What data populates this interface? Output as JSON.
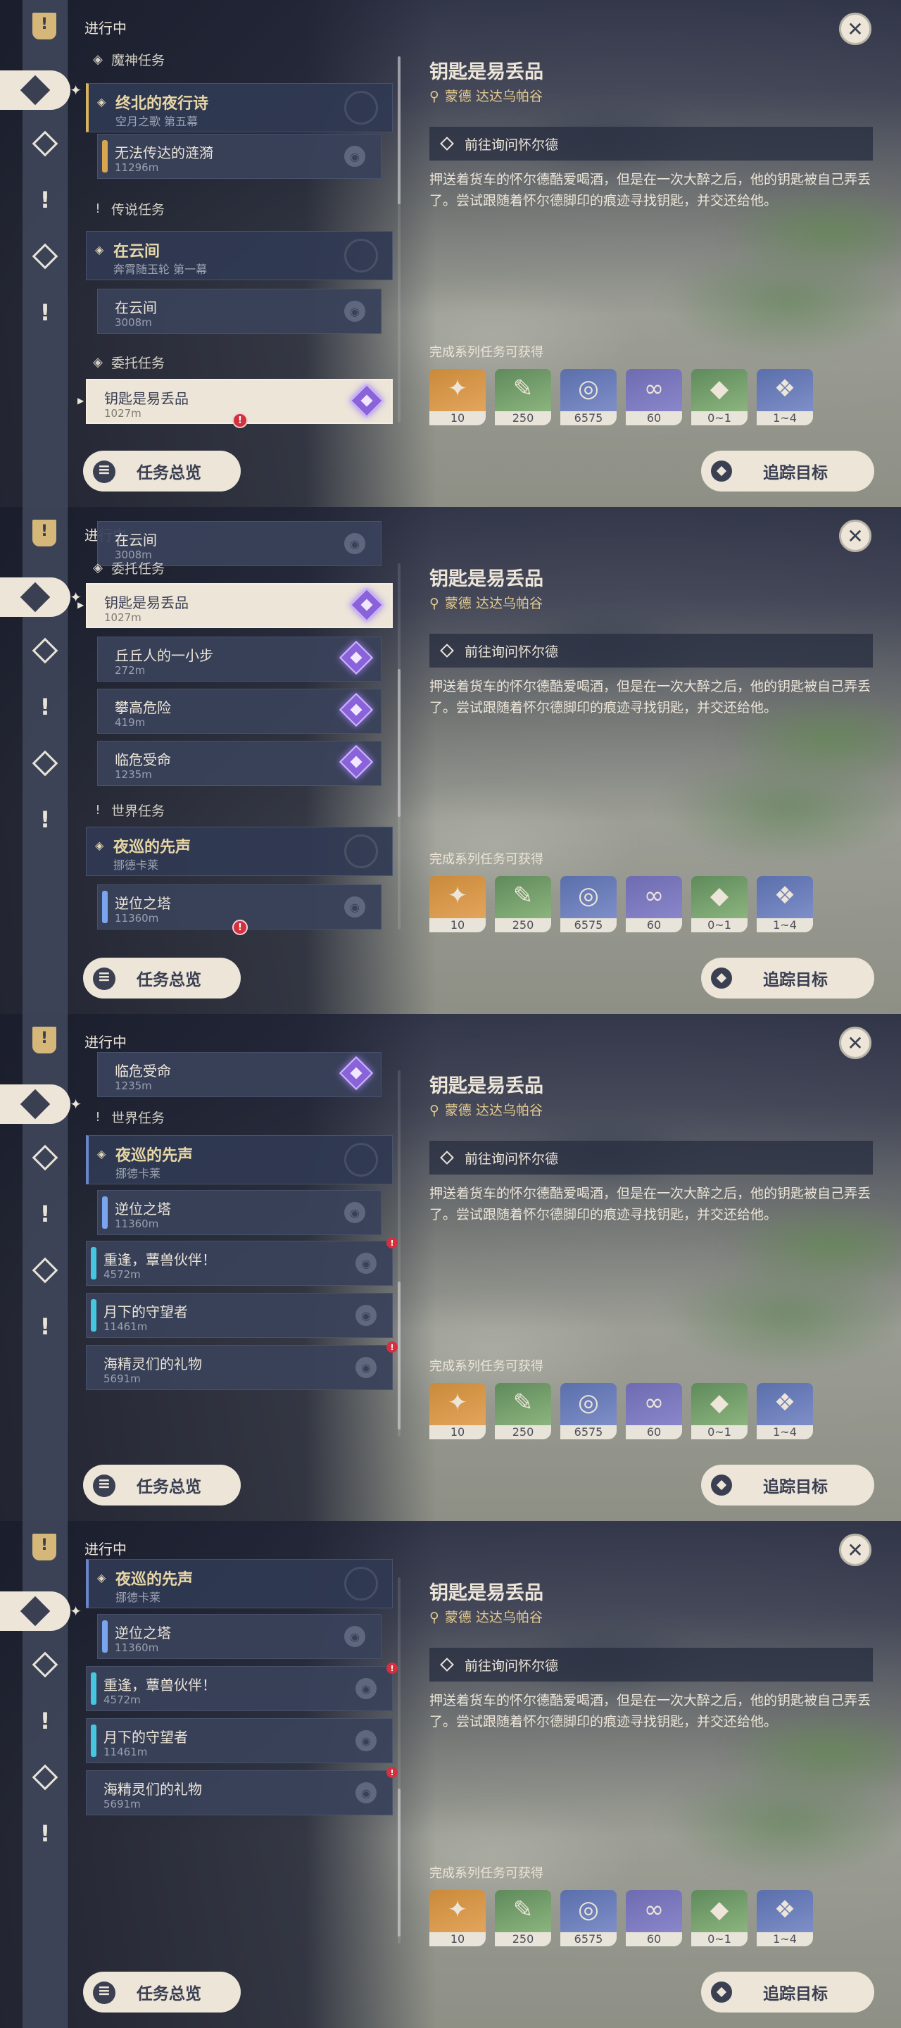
{
  "header": {
    "section_title": "进行中",
    "close_symbol": "✕"
  },
  "icons": {
    "rail": [
      "quest-bookmark-icon",
      "all-quests-icon",
      "archon-quest-icon",
      "story-quest-icon",
      "commission-icon",
      "world-quest-icon"
    ],
    "pin": "map-pin-icon",
    "track": "track-diamond-icon"
  },
  "colors": {
    "accent_gold": "#d9b35f",
    "commission_purple": "#8a62d9",
    "world_cyan": "#45c7e2",
    "alert_red": "#d33040",
    "cream": "#ece5d8"
  },
  "categories": {
    "archon": "魔神任务",
    "legend": "传说任务",
    "commission": "委托任务",
    "world": "世界任务"
  },
  "quests": {
    "archon_chapter": {
      "title": "终北的夜行诗",
      "subtitle": "空月之歌 第五幕"
    },
    "archon_step": {
      "title": "无法传达的涟漪",
      "distance": "11296m"
    },
    "legend_chapter": {
      "title": "在云间",
      "subtitle": "奔霄随玉轮 第一幕"
    },
    "legend_step": {
      "title": "在云间",
      "distance": "3008m"
    },
    "commissions": [
      {
        "title": "钥匙是易丢品",
        "distance": "1027m"
      },
      {
        "title": "丘丘人的一小步",
        "distance": "272m"
      },
      {
        "title": "攀高危险",
        "distance": "419m"
      },
      {
        "title": "临危受命",
        "distance": "1235m"
      }
    ],
    "world_chapter": {
      "title": "夜巡的先声",
      "subtitle": "挪德卡莱"
    },
    "world_steps": [
      {
        "title": "逆位之塔",
        "distance": "11360m"
      },
      {
        "title": "重逢，蕈兽伙伴！",
        "distance": "4572m"
      },
      {
        "title": "月下的守望者",
        "distance": "11461m"
      },
      {
        "title": "海精灵们的礼物",
        "distance": "5691m"
      }
    ]
  },
  "detail": {
    "title": "钥匙是易丢品",
    "location": "蒙德 达达乌帕谷",
    "objective": "前往询问怀尔德",
    "description": "押送着货车的怀尔德酷爱喝酒，但是在一次大醉之后，他的钥匙被自己弄丢了。尝试跟随着怀尔德脚印的痕迹寻找钥匙，并交还给他。",
    "rewards_label": "完成系列任务可获得",
    "rewards": [
      {
        "icon": "primogem-icon",
        "count": "10",
        "color": "orange"
      },
      {
        "icon": "adventure-exp-icon",
        "count": "250",
        "color": "green"
      },
      {
        "icon": "mora-icon",
        "count": "6575",
        "color": "blue"
      },
      {
        "icon": "companionship-exp-icon",
        "count": "60",
        "color": "purple"
      },
      {
        "icon": "crystal-pink-icon",
        "count": "0~1",
        "color": "green"
      },
      {
        "icon": "crystal-cluster-icon",
        "count": "1~4",
        "color": "blue"
      }
    ]
  },
  "buttons": {
    "overview": "任务总览",
    "track": "追踪目标"
  }
}
